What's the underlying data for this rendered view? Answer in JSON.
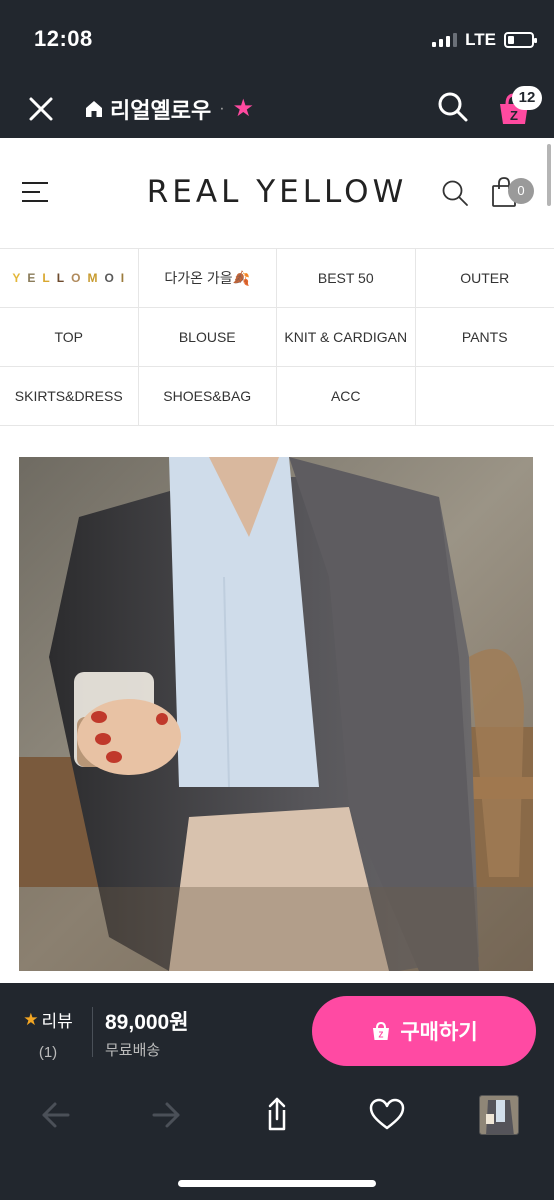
{
  "status_bar": {
    "time": "12:08",
    "network": "LTE",
    "battery_level": 0.25
  },
  "app_header": {
    "shop_name": "리얼옐로우",
    "separator": "·",
    "cart_count": "12",
    "icons": {
      "close": "close-icon",
      "home": "home-icon",
      "favorite": "star-icon",
      "search": "search-icon",
      "cart": "zigzag-bag-icon"
    },
    "colors": {
      "favorite": "#ff4aa0"
    }
  },
  "site": {
    "logo": "REAL YELLOW",
    "cart_count": "0",
    "icons": {
      "menu": "hamburger-icon",
      "search": "search-icon",
      "bag": "shopping-bag-icon"
    }
  },
  "categories": [
    [
      "YELLOMOI",
      "다가온 가을🍂",
      "BEST 50",
      "OUTER"
    ],
    [
      "TOP",
      "BLOUSE",
      "KNIT & CARDIGAN",
      "PANTS"
    ],
    [
      "SKIRTS&DRESS",
      "SHOES&BAG",
      "ACC",
      ""
    ]
  ],
  "yellomoi_letters": [
    "Y",
    "E",
    "L",
    "L",
    "O",
    "M",
    "O",
    "I"
  ],
  "product": {
    "review_label": "리뷰",
    "review_count": "(1)",
    "price": "89,000원",
    "shipping": "무료배송",
    "buy_label": "구매하기",
    "colors": {
      "buy_button": "#ff4aa3",
      "review_star": "#f3a623"
    }
  },
  "nav_bar": {
    "icons": [
      "back-arrow-icon",
      "forward-arrow-icon",
      "share-icon",
      "heart-icon",
      "recent-product-thumbnail"
    ]
  }
}
